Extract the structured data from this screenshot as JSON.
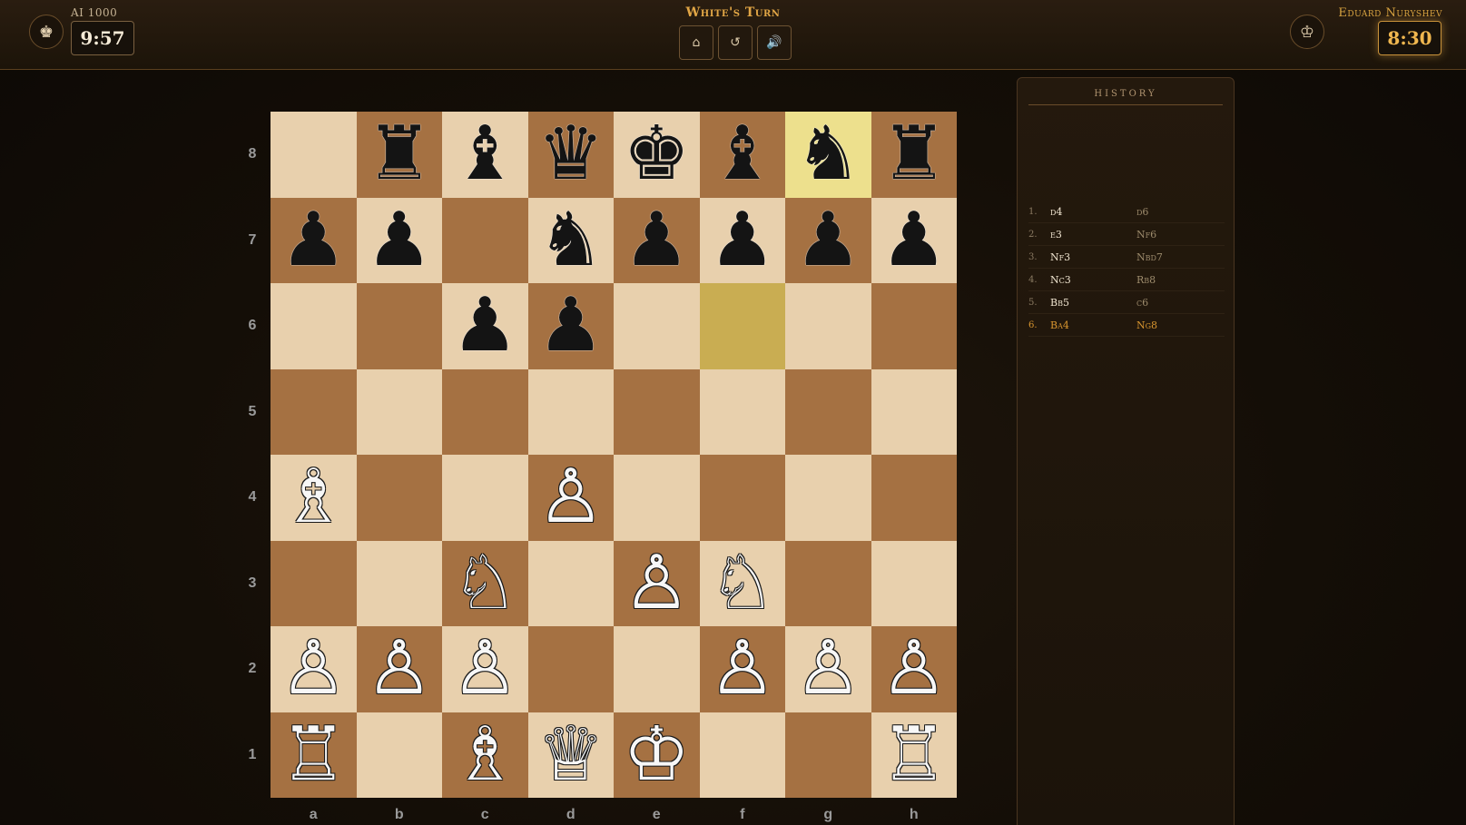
{
  "header": {
    "turn_text": "White's Turn",
    "controls": {
      "home": "⌂",
      "undo": "↺",
      "sound": "🔊"
    }
  },
  "players": {
    "opponent": {
      "name": "AI 1000",
      "clock": "9:57",
      "avatar": "♚"
    },
    "user": {
      "name": "Eduard Nuryshev",
      "clock": "8:30",
      "avatar": "♔"
    }
  },
  "board": {
    "ranks": [
      "8",
      "7",
      "6",
      "5",
      "4",
      "3",
      "2",
      "1"
    ],
    "files": [
      "a",
      "b",
      "c",
      "d",
      "e",
      "f",
      "g",
      "h"
    ],
    "pieces": [
      [
        "",
        "♜",
        "♝",
        "♛",
        "♚",
        "♝",
        "♞",
        "♜"
      ],
      [
        "♟",
        "♟",
        "",
        "♞",
        "♟",
        "♟",
        "♟",
        "♟"
      ],
      [
        "",
        "",
        "♟",
        "♟",
        "",
        "",
        "",
        ""
      ],
      [
        "",
        "",
        "",
        "",
        "",
        "",
        "",
        ""
      ],
      [
        "♗",
        "",
        "",
        "♙",
        "",
        "",
        "",
        ""
      ],
      [
        "",
        "",
        "♘",
        "",
        "♙",
        "♘",
        "",
        ""
      ],
      [
        "♙",
        "♙",
        "♙",
        "",
        "",
        "♙",
        "♙",
        "♙"
      ],
      [
        "♖",
        "",
        "♗",
        "♕",
        "♔",
        "",
        "",
        "♖"
      ]
    ],
    "colors": [
      [
        "",
        "b",
        "b",
        "b",
        "b",
        "b",
        "b",
        "b"
      ],
      [
        "b",
        "b",
        "",
        "b",
        "b",
        "b",
        "b",
        "b"
      ],
      [
        "",
        "",
        "b",
        "b",
        "",
        "",
        "",
        ""
      ],
      [
        "",
        "",
        "",
        "",
        "",
        "",
        "",
        ""
      ],
      [
        "w",
        "",
        "",
        "w",
        "",
        "",
        "",
        ""
      ],
      [
        "",
        "",
        "w",
        "",
        "w",
        "w",
        "",
        ""
      ],
      [
        "w",
        "w",
        "w",
        "",
        "",
        "w",
        "w",
        "w"
      ],
      [
        "w",
        "",
        "w",
        "w",
        "w",
        "",
        "",
        "w"
      ]
    ],
    "last_move": {
      "from": "f6",
      "to": "g8"
    },
    "colors_hex": {
      "light": "#e8d0ad",
      "dark": "#a57142",
      "from": "#c9ad52",
      "to": "#ede08d"
    }
  },
  "history": {
    "title": "History",
    "moves": [
      {
        "num": "1.",
        "white": "d4",
        "black": "d6"
      },
      {
        "num": "2.",
        "white": "e3",
        "black": "Nf6"
      },
      {
        "num": "3.",
        "white": "Nf3",
        "black": "Nbd7"
      },
      {
        "num": "4.",
        "white": "Nc3",
        "black": "Rb8"
      },
      {
        "num": "5.",
        "white": "Bb5",
        "black": "c6"
      },
      {
        "num": "6.",
        "white": "Ba4",
        "black": "Ng8"
      }
    ]
  }
}
